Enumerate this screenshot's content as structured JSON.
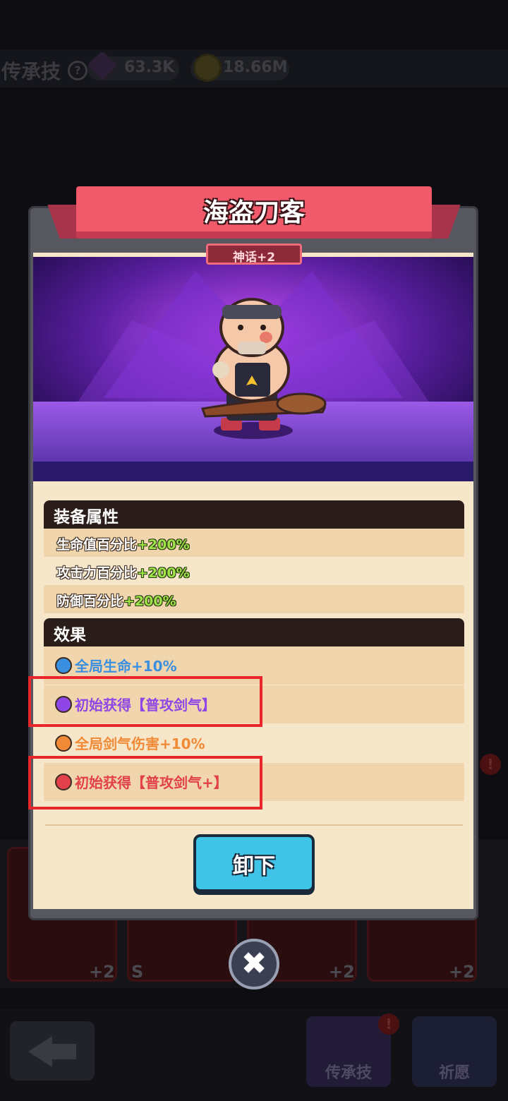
{
  "topbar": {
    "title": "传承技",
    "help_icon": "?",
    "gems": "63.3K",
    "coins": "18.66M"
  },
  "background": {
    "card_levels": [
      "+2",
      "S",
      "+2",
      "+2"
    ],
    "nav": {
      "legacy_label": "传承技",
      "wish_label": "祈愿",
      "alert": "!"
    }
  },
  "modal": {
    "title": "海盗刀客",
    "rank": "神话+2",
    "stats_header": "装备属性",
    "stats": [
      {
        "label": "生命值百分比",
        "value": "+200%"
      },
      {
        "label": "攻击力百分比",
        "value": "+200%"
      },
      {
        "label": "防御百分比",
        "value": "+200%"
      }
    ],
    "effects_header": "效果",
    "effects": [
      {
        "text": "全局生命+10%",
        "color": "#3b8fe0",
        "dot": "#3b8fe0"
      },
      {
        "text": "初始获得【普攻剑气】",
        "color": "#8f46e6",
        "dot": "#8f46e6"
      },
      {
        "text": "全局剑气伤害+10%",
        "color": "#f08a36",
        "dot": "#f08a36"
      },
      {
        "text": "初始获得【普攻剑气+】",
        "color": "#e2404a",
        "dot": "#e2404a"
      }
    ],
    "unequip_label": "卸下",
    "close_label": "✖"
  },
  "colors": {
    "banner": "#f05a6a",
    "highlight_box": "#e8262c",
    "button": "#3fc3e6",
    "stat_value": "#9fe34a"
  }
}
